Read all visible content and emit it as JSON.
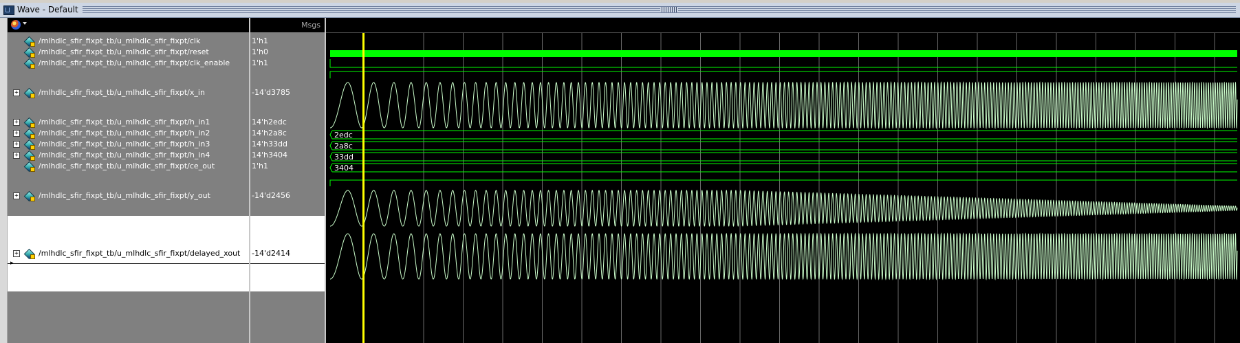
{
  "window": {
    "title": "Wave - Default"
  },
  "header": {
    "msgs_label": "Msgs"
  },
  "signals": [
    {
      "name": "/mlhdlc_sfir_fixpt_tb/u_mlhdlc_sfir_fixpt/clk",
      "value": "1'h1",
      "expandable": false
    },
    {
      "name": "/mlhdlc_sfir_fixpt_tb/u_mlhdlc_sfir_fixpt/reset",
      "value": "1'h0",
      "expandable": false
    },
    {
      "name": "/mlhdlc_sfir_fixpt_tb/u_mlhdlc_sfir_fixpt/clk_enable",
      "value": "1'h1",
      "expandable": false
    },
    {
      "name": "/mlhdlc_sfir_fixpt_tb/u_mlhdlc_sfir_fixpt/x_in",
      "value": "-14'd3785",
      "expandable": true
    },
    {
      "name": "/mlhdlc_sfir_fixpt_tb/u_mlhdlc_sfir_fixpt/h_in1",
      "value": "14'h2edc",
      "expandable": true,
      "bus_label": "2edc"
    },
    {
      "name": "/mlhdlc_sfir_fixpt_tb/u_mlhdlc_sfir_fixpt/h_in2",
      "value": "14'h2a8c",
      "expandable": true,
      "bus_label": "2a8c"
    },
    {
      "name": "/mlhdlc_sfir_fixpt_tb/u_mlhdlc_sfir_fixpt/h_in3",
      "value": "14'h33dd",
      "expandable": true,
      "bus_label": "33dd"
    },
    {
      "name": "/mlhdlc_sfir_fixpt_tb/u_mlhdlc_sfir_fixpt/h_in4",
      "value": "14'h3404",
      "expandable": true,
      "bus_label": "3404"
    },
    {
      "name": "/mlhdlc_sfir_fixpt_tb/u_mlhdlc_sfir_fixpt/ce_out",
      "value": "1'h1",
      "expandable": false
    },
    {
      "name": "/mlhdlc_sfir_fixpt_tb/u_mlhdlc_sfir_fixpt/y_out",
      "value": "-14'd2456",
      "expandable": true
    },
    {
      "name": "/mlhdlc_sfir_fixpt_tb/u_mlhdlc_sfir_fixpt/delayed_xout",
      "value": "-14'd2414",
      "expandable": true,
      "selected": true
    }
  ],
  "colors": {
    "wave_green": "#00ff00",
    "analog_wave": "#ccffcc",
    "cursor": "#ffff00",
    "pane_bg": "#808080",
    "wave_bg": "#000000"
  }
}
